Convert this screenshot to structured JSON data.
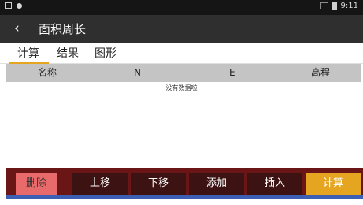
{
  "status": {
    "time": "9:11"
  },
  "appbar": {
    "back_icon": "‹",
    "title": "面积周长"
  },
  "tabs": [
    "计算",
    "结果",
    "图形"
  ],
  "table": {
    "headers": [
      "名称",
      "N",
      "E",
      "高程"
    ],
    "empty_text": "没有数据啦"
  },
  "buttons": {
    "delete": "删除",
    "move_up": "上移",
    "move_down": "下移",
    "add": "添加",
    "insert": "插入",
    "calculate": "计算"
  }
}
